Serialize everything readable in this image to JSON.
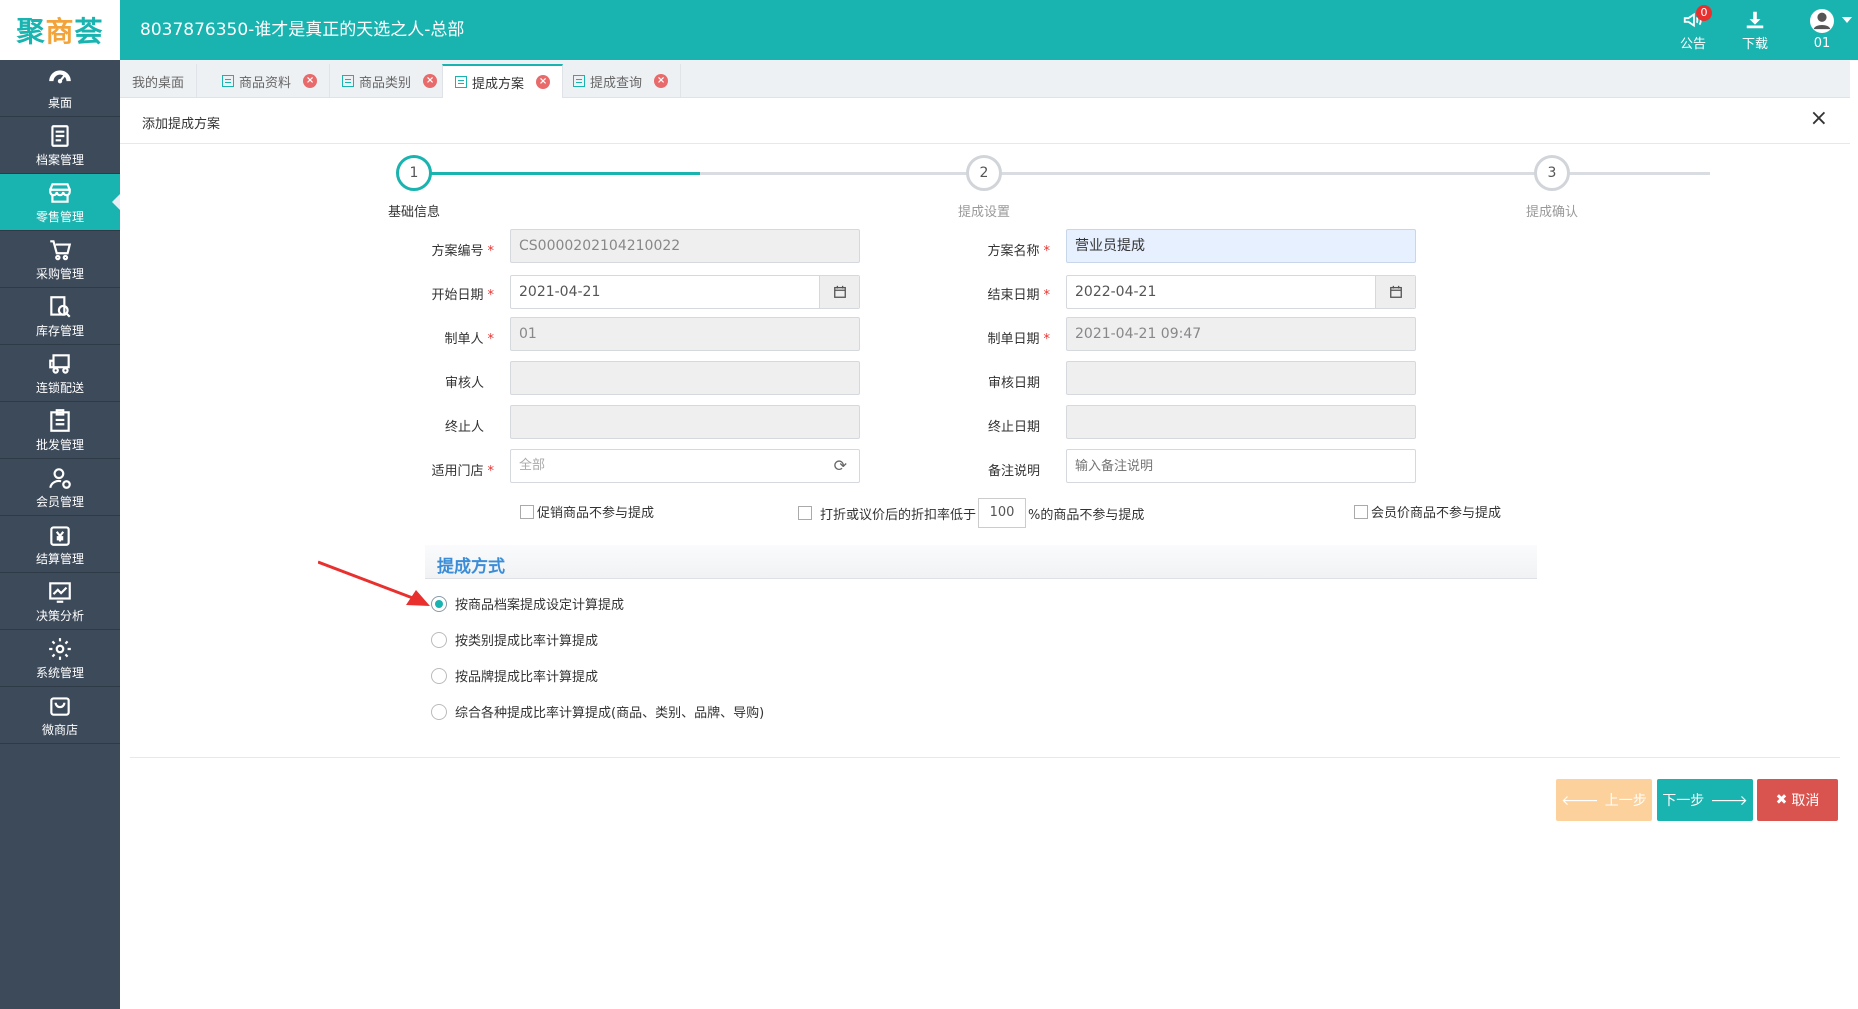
{
  "header": {
    "logo_a": "聚",
    "logo_b": "商",
    "logo_c": "荟",
    "title": "8037876350-谁才是真正的天选之人-总部",
    "notice_label": "公告",
    "notice_count": "0",
    "download_label": "下载",
    "user_label": "01"
  },
  "sidebar": {
    "items": [
      {
        "label": "桌面",
        "icon": "dashboard-icon"
      },
      {
        "label": "档案管理",
        "icon": "archive-icon"
      },
      {
        "label": "零售管理",
        "icon": "store-icon"
      },
      {
        "label": "采购管理",
        "icon": "cart-icon"
      },
      {
        "label": "库存管理",
        "icon": "inventory-search-icon"
      },
      {
        "label": "连锁配送",
        "icon": "truck-icon"
      },
      {
        "label": "批发管理",
        "icon": "wholesale-icon"
      },
      {
        "label": "会员管理",
        "icon": "member-icon"
      },
      {
        "label": "结算管理",
        "icon": "yen-icon"
      },
      {
        "label": "决策分析",
        "icon": "chart-icon"
      },
      {
        "label": "系统管理",
        "icon": "gear-icon"
      },
      {
        "label": "微商店",
        "icon": "shop-bag-icon"
      }
    ],
    "active_index": 2
  },
  "tabs": [
    {
      "label": "我的桌面"
    },
    {
      "label": "商品资料"
    },
    {
      "label": "商品类别"
    },
    {
      "label": "提成方案"
    },
    {
      "label": "提成查询"
    }
  ],
  "panel": {
    "title": "添加提成方案",
    "close": "×"
  },
  "steps": [
    {
      "num": "1",
      "label": "基础信息"
    },
    {
      "num": "2",
      "label": "提成设置"
    },
    {
      "num": "3",
      "label": "提成确认"
    }
  ],
  "form": {
    "code_label": "方案编号",
    "code_value": "CS0000202104210022",
    "name_label": "方案名称",
    "name_value": "营业员提成",
    "start_label": "开始日期",
    "start_value": "2021-04-21",
    "end_label": "结束日期",
    "end_value": "2022-04-21",
    "maker_label": "制单人",
    "maker_value": "01",
    "make_date_label": "制单日期",
    "make_date_value": "2021-04-21 09:47",
    "auditor_label": "审核人",
    "audit_date_label": "审核日期",
    "stopper_label": "终止人",
    "stop_date_label": "终止日期",
    "store_label": "适用门店",
    "store_value": "全部",
    "remark_label": "备注说明",
    "remark_placeholder": "输入备注说明",
    "required_mark": "*"
  },
  "options": {
    "promo_label": "促销商品不参与提成",
    "discount_prefix": "打折或议价后的折扣率低于",
    "discount_value": "100",
    "discount_suffix": "%的商品不参与提成",
    "member_label": "会员价商品不参与提成"
  },
  "section": {
    "title": "提成方式"
  },
  "methods": [
    {
      "label": "按商品档案提成设定计算提成",
      "checked": true
    },
    {
      "label": "按类别提成比率计算提成",
      "checked": false
    },
    {
      "label": "按品牌提成比率计算提成",
      "checked": false
    },
    {
      "label": "综合各种提成比率计算提成(商品、类别、品牌、导购)",
      "checked": false
    }
  ],
  "buttons": {
    "prev": "上一步",
    "next": "下一步",
    "cancel": "取消"
  },
  "colors": {
    "accent": "#19b3b0",
    "sidebar": "#3d4a5a",
    "danger": "#d9534f",
    "prev_disabled": "#fcd19c",
    "arrow": "#e8312f"
  }
}
